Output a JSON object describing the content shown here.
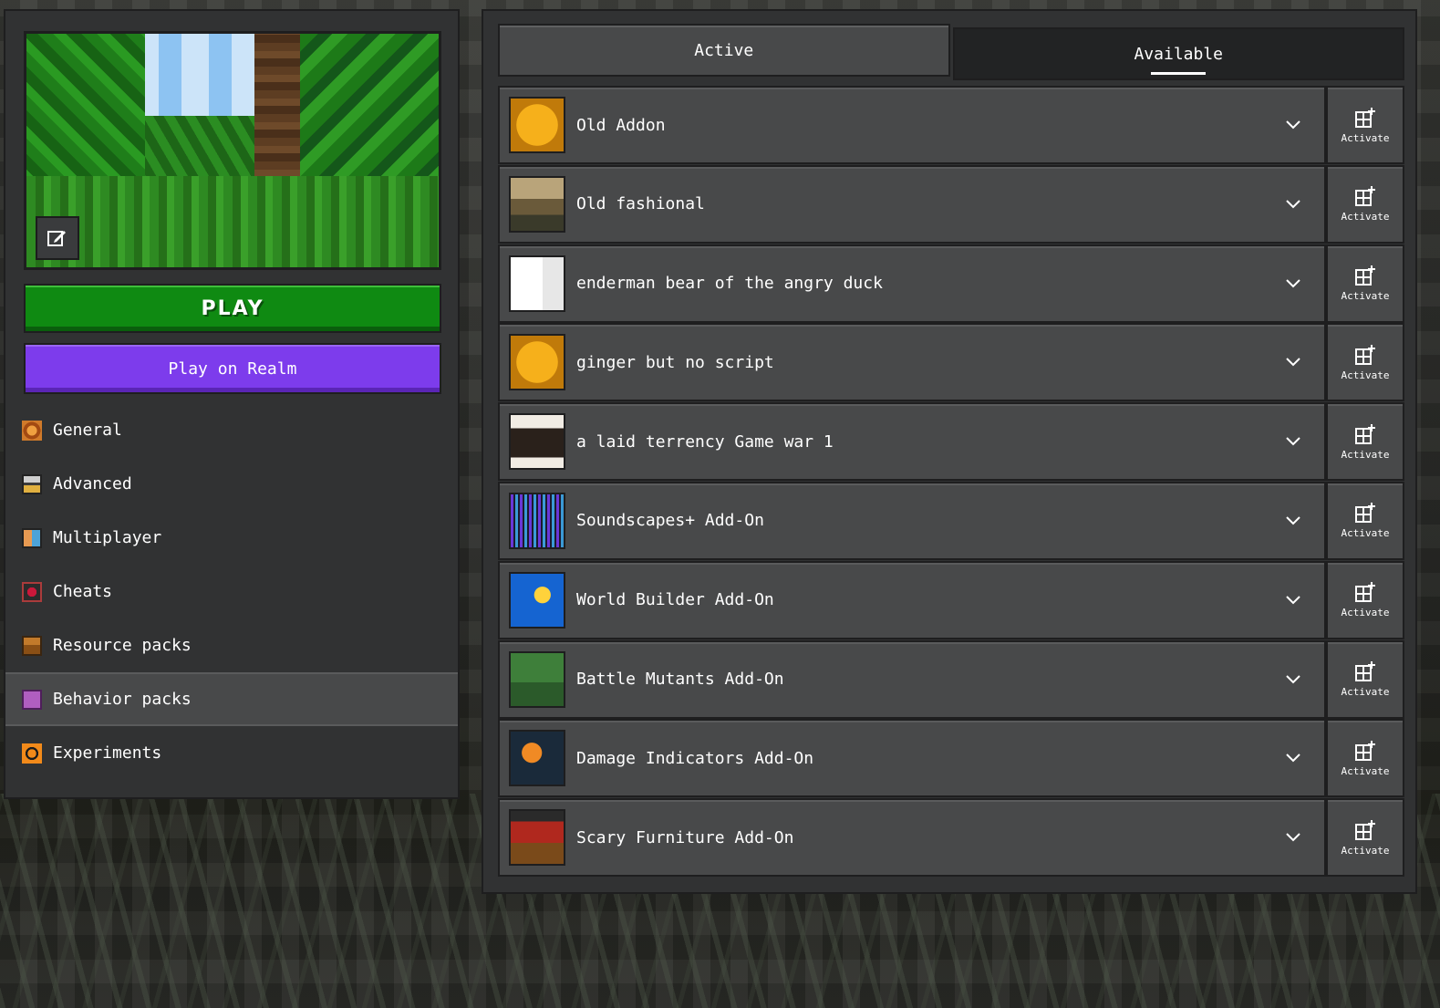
{
  "colors": {
    "play": "#0f8a12",
    "realm": "#7d3cec",
    "panel": "#313233",
    "row": "#48494a"
  },
  "sidebar": {
    "edit_icon": "edit-image-icon",
    "play_label": "PLAY",
    "realm_label": "Play on Realm",
    "items": [
      {
        "label": "General",
        "icon": "gear-icon"
      },
      {
        "label": "Advanced",
        "icon": "advanced-icon"
      },
      {
        "label": "Multiplayer",
        "icon": "multiplayer-icon"
      },
      {
        "label": "Cheats",
        "icon": "cheats-icon"
      },
      {
        "label": "Resource packs",
        "icon": "resource-packs-icon"
      },
      {
        "label": "Behavior packs",
        "icon": "behavior-packs-icon",
        "selected": true
      },
      {
        "label": "Experiments",
        "icon": "experiments-icon"
      }
    ]
  },
  "tabs": {
    "active_label": "Active",
    "available_label": "Available",
    "selected": "Available"
  },
  "packs": [
    {
      "name": "Old Addon",
      "icon": "addon-tools-icon",
      "action": "Activate"
    },
    {
      "name": "Old fashional",
      "icon": "house-icon",
      "action": "Activate"
    },
    {
      "name": "enderman bear of the angry duck",
      "icon": "enderman-icon",
      "action": "Activate"
    },
    {
      "name": "ginger but no script",
      "icon": "addon-tools-icon",
      "action": "Activate"
    },
    {
      "name": "a laid terrency Game war 1",
      "icon": "fireplace-icon",
      "action": "Activate"
    },
    {
      "name": "Soundscapes+ Add-On",
      "icon": "soundwave-icon",
      "action": "Activate"
    },
    {
      "name": "World Builder Add-On",
      "icon": "magic-wand-icon",
      "action": "Activate"
    },
    {
      "name": "Battle Mutants Add-On",
      "icon": "mutant-icon",
      "action": "Activate"
    },
    {
      "name": "Damage Indicators Add-On",
      "icon": "damage-icon",
      "action": "Activate"
    },
    {
      "name": "Scary Furniture Add-On",
      "icon": "chest-monster-icon",
      "action": "Activate"
    }
  ]
}
